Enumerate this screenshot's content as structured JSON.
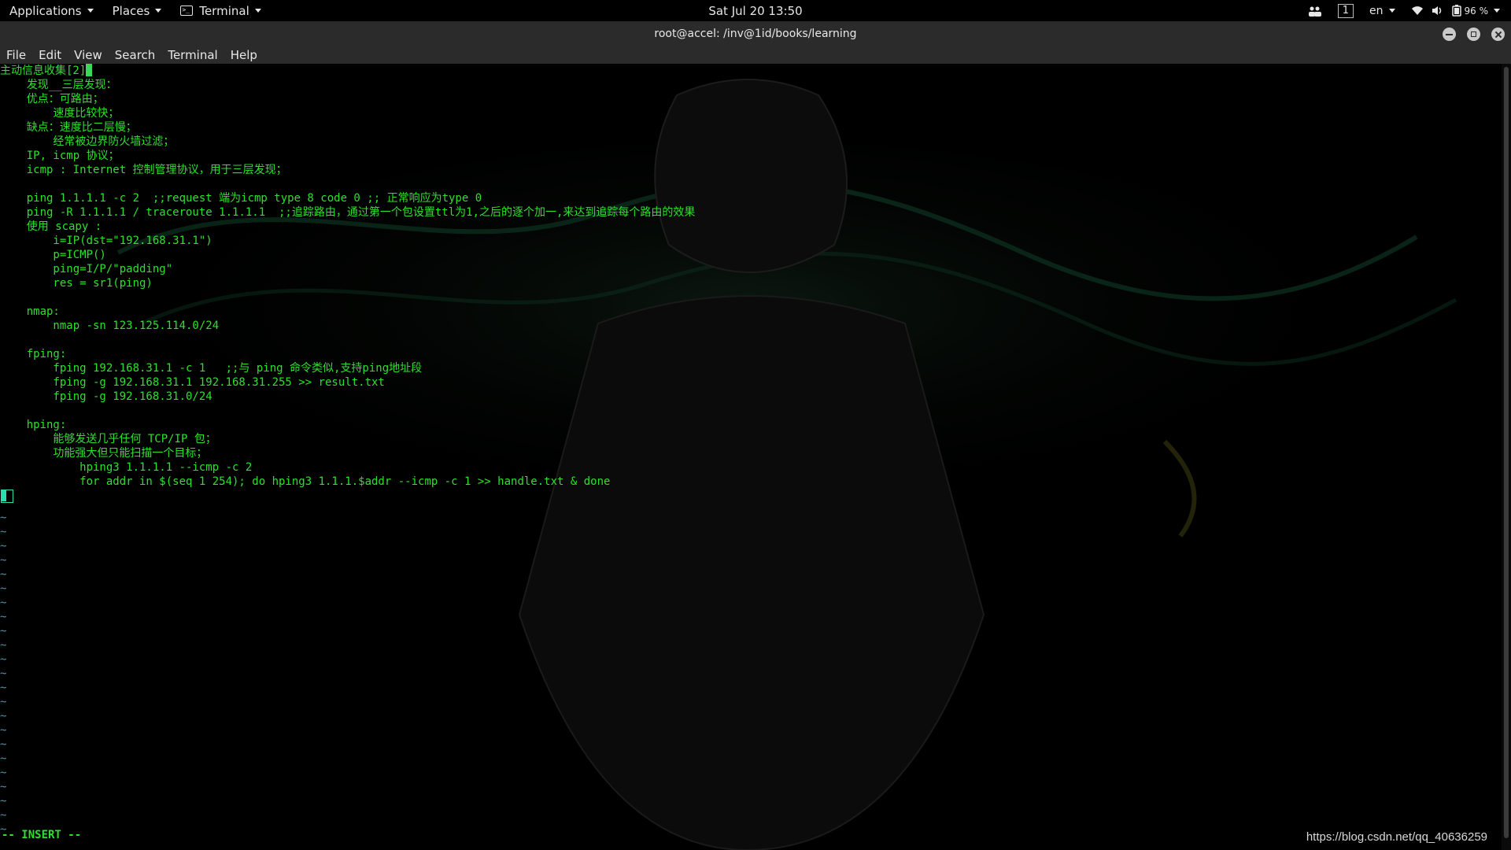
{
  "topbar": {
    "applications": "Applications",
    "places": "Places",
    "terminal": "Terminal",
    "clock": "Sat Jul 20  13:50",
    "workspace": "1",
    "language": "en",
    "battery": "96 %"
  },
  "window": {
    "title": "root@accel: /inv@1id/books/learning"
  },
  "menu": {
    "file": "File",
    "edit": "Edit",
    "view": "View",
    "search": "Search",
    "terminal": "Terminal",
    "help": "Help"
  },
  "vim": {
    "lines": [
      "主动信息收集[2]",
      "    发现__三层发现：",
      "    优点：可路由；",
      "        速度比较快；",
      "    缺点：速度比二层慢；",
      "        经常被边界防火墙过滤；",
      "    IP, icmp 协议；",
      "    icmp : Internet 控制管理协议，用于三层发现；",
      "",
      "    ping 1.1.1.1 -c 2  ;;request 端为icmp type 8 code 0 ;; 正常响应为type 0",
      "    ping -R 1.1.1.1 / traceroute 1.1.1.1  ;;追踪路由，通过第一个包设置ttl为1,之后的逐个加一,来达到追踪每个路由的效果",
      "    使用 scapy :",
      "        i=IP(dst=\"192.168.31.1\")",
      "        p=ICMP()",
      "        ping=I/P/\"padding\"",
      "        res = sr1(ping)",
      "",
      "    nmap:",
      "        nmap -sn 123.125.114.0/24",
      "",
      "    fping:",
      "        fping 192.168.31.1 -c 1   ;;与 ping 命令类似,支持ping地址段",
      "        fping -g 192.168.31.1 192.168.31.255 >> result.txt",
      "        fping -g 192.168.31.0/24",
      "",
      "    hping:",
      "        能够发送几乎任何 TCP/IP 包；",
      "        功能强大但只能扫描一个目标；",
      "            hping3 1.1.1.1 --icmp -c 2",
      "            for addr in $(seq 1 254); do hping3 1.1.1.$addr --icmp -c 1 >> handle.txt & done"
    ],
    "tildes": "~\n~\n~\n~\n~\n~\n~\n~\n~\n~\n~\n~\n~\n~\n~\n~\n~\n~\n~\n~\n~\n~\n~",
    "mode": "-- INSERT --"
  },
  "watermark": "https://blog.csdn.net/qq_40636259",
  "colors": {
    "text": "#2ee02e",
    "tilde": "#1f9fd8",
    "cursor": "#27e0b0",
    "chrome": "#2b2b2b"
  }
}
